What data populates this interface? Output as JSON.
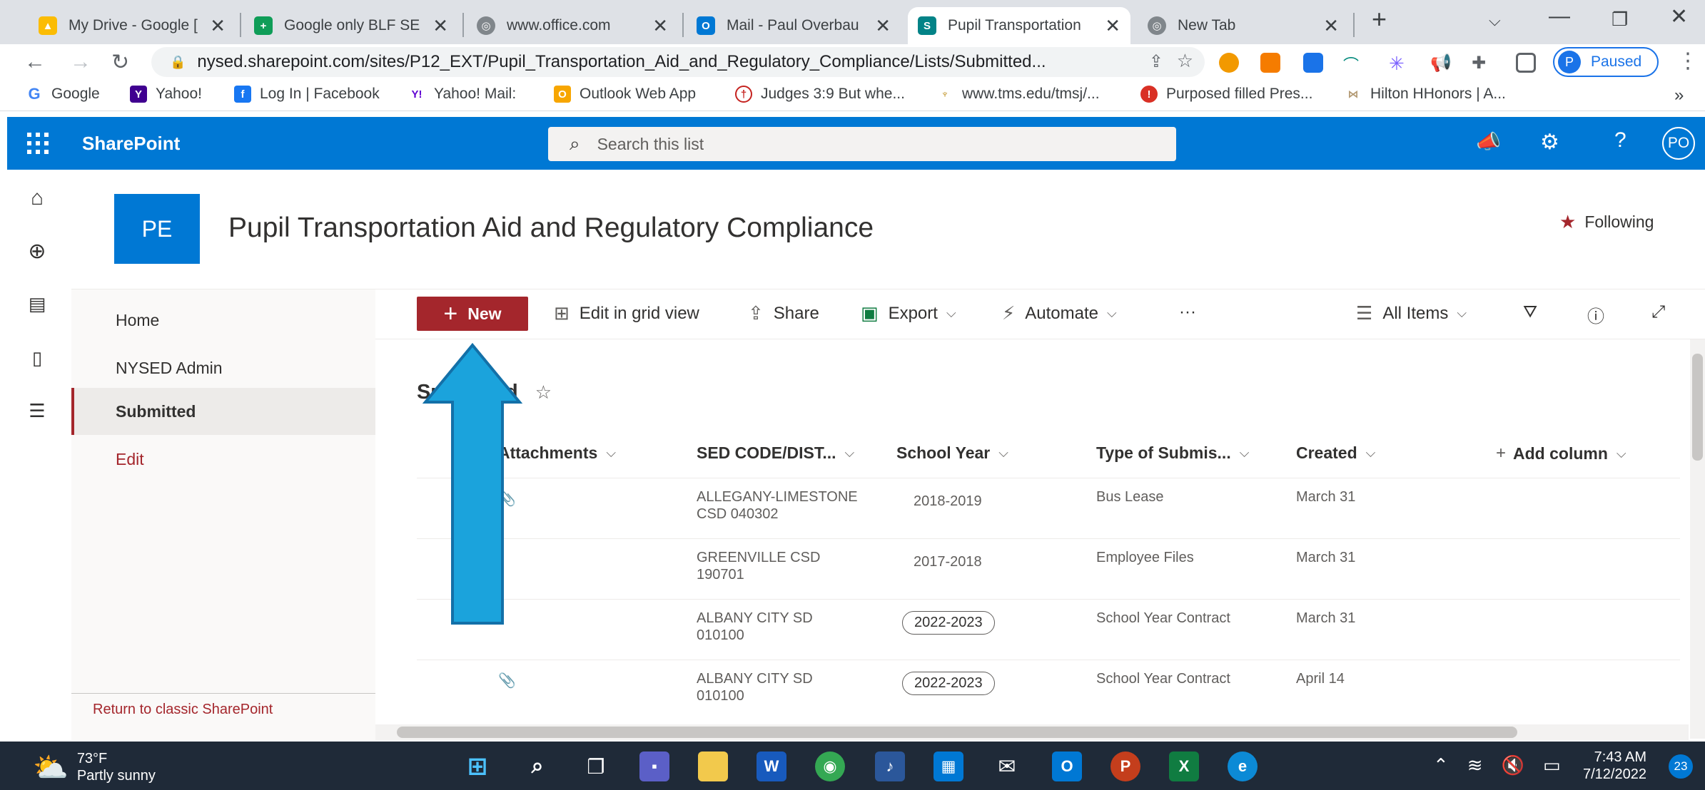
{
  "browser": {
    "tabs": [
      {
        "title": "My Drive - Google [",
        "icon": "google-drive-icon",
        "color": "#1fa463"
      },
      {
        "title": "Google only BLF SE",
        "icon": "google-sheets-icon",
        "color": "#0f9d58"
      },
      {
        "title": "www.office.com",
        "icon": "globe-icon",
        "color": "#5f6368"
      },
      {
        "title": "Mail - Paul Overbau",
        "icon": "outlook-icon",
        "color": "#0078d4"
      },
      {
        "title": "Pupil Transportation",
        "icon": "sharepoint-icon",
        "color": "#038387",
        "active": true
      },
      {
        "title": "New Tab",
        "icon": "globe-icon",
        "color": "#5f6368"
      }
    ],
    "url": "nysed.sharepoint.com/sites/P12_EXT/Pupil_Transportation_Aid_and_Regulatory_Compliance/Lists/Submitted...",
    "profile_status": "Paused",
    "profile_initial": "P",
    "bookmarks": [
      "Google",
      "Yahoo!",
      "Log In | Facebook",
      "Yahoo! Mail:",
      "Outlook Web App",
      "Judges 3:9 But whe...",
      "www.tms.edu/tmsj/...",
      "Purposed filled Pres...",
      "Hilton HHonors | A..."
    ]
  },
  "suite": {
    "brand": "SharePoint",
    "search_placeholder": "Search this list",
    "user_initials": "PO"
  },
  "site": {
    "logo": "PE",
    "title": "Pupil Transportation Aid and Regulatory Compliance",
    "following_label": "Following"
  },
  "nav": {
    "items": [
      "Home",
      "NYSED Admin",
      "Submitted",
      "Edit"
    ],
    "selected": "Submitted",
    "classic_link": "Return to classic SharePoint"
  },
  "commands": {
    "new": "New",
    "grid": "Edit in grid view",
    "share": "Share",
    "export": "Export",
    "automate": "Automate",
    "more": "···",
    "view": "All Items"
  },
  "list": {
    "title": "Submitted",
    "columns": [
      "Attachments",
      "SED CODE/DIST...",
      "School Year",
      "Type of Submis...",
      "Created",
      "Add column"
    ],
    "rows": [
      {
        "attachment": true,
        "sed_line1": "ALLEGANY-LIMESTONE",
        "sed_line2": "CSD 040302",
        "year": "2018-2019",
        "year_pill": false,
        "type": "Bus Lease",
        "created": "March 31"
      },
      {
        "attachment": false,
        "sed_line1": "GREENVILLE CSD",
        "sed_line2": "190701",
        "year": "2017-2018",
        "year_pill": false,
        "type": "Employee Files",
        "created": "March 31"
      },
      {
        "attachment": false,
        "sed_line1": "ALBANY CITY SD",
        "sed_line2": "010100",
        "year": "2022-2023",
        "year_pill": true,
        "type": "School Year Contract",
        "created": "March 31"
      },
      {
        "attachment": true,
        "sed_line1": "ALBANY CITY SD",
        "sed_line2": "010100",
        "year": "2022-2023",
        "year_pill": true,
        "type": "School Year Contract",
        "created": "April 14"
      }
    ]
  },
  "taskbar": {
    "temperature": "73°F",
    "weather": "Partly sunny",
    "time": "7:43 AM",
    "date": "7/12/2022",
    "notifications": "23"
  },
  "colors": {
    "accent": "#a4262c",
    "suite": "#0078d4",
    "arrow": "#1ba3dc"
  }
}
